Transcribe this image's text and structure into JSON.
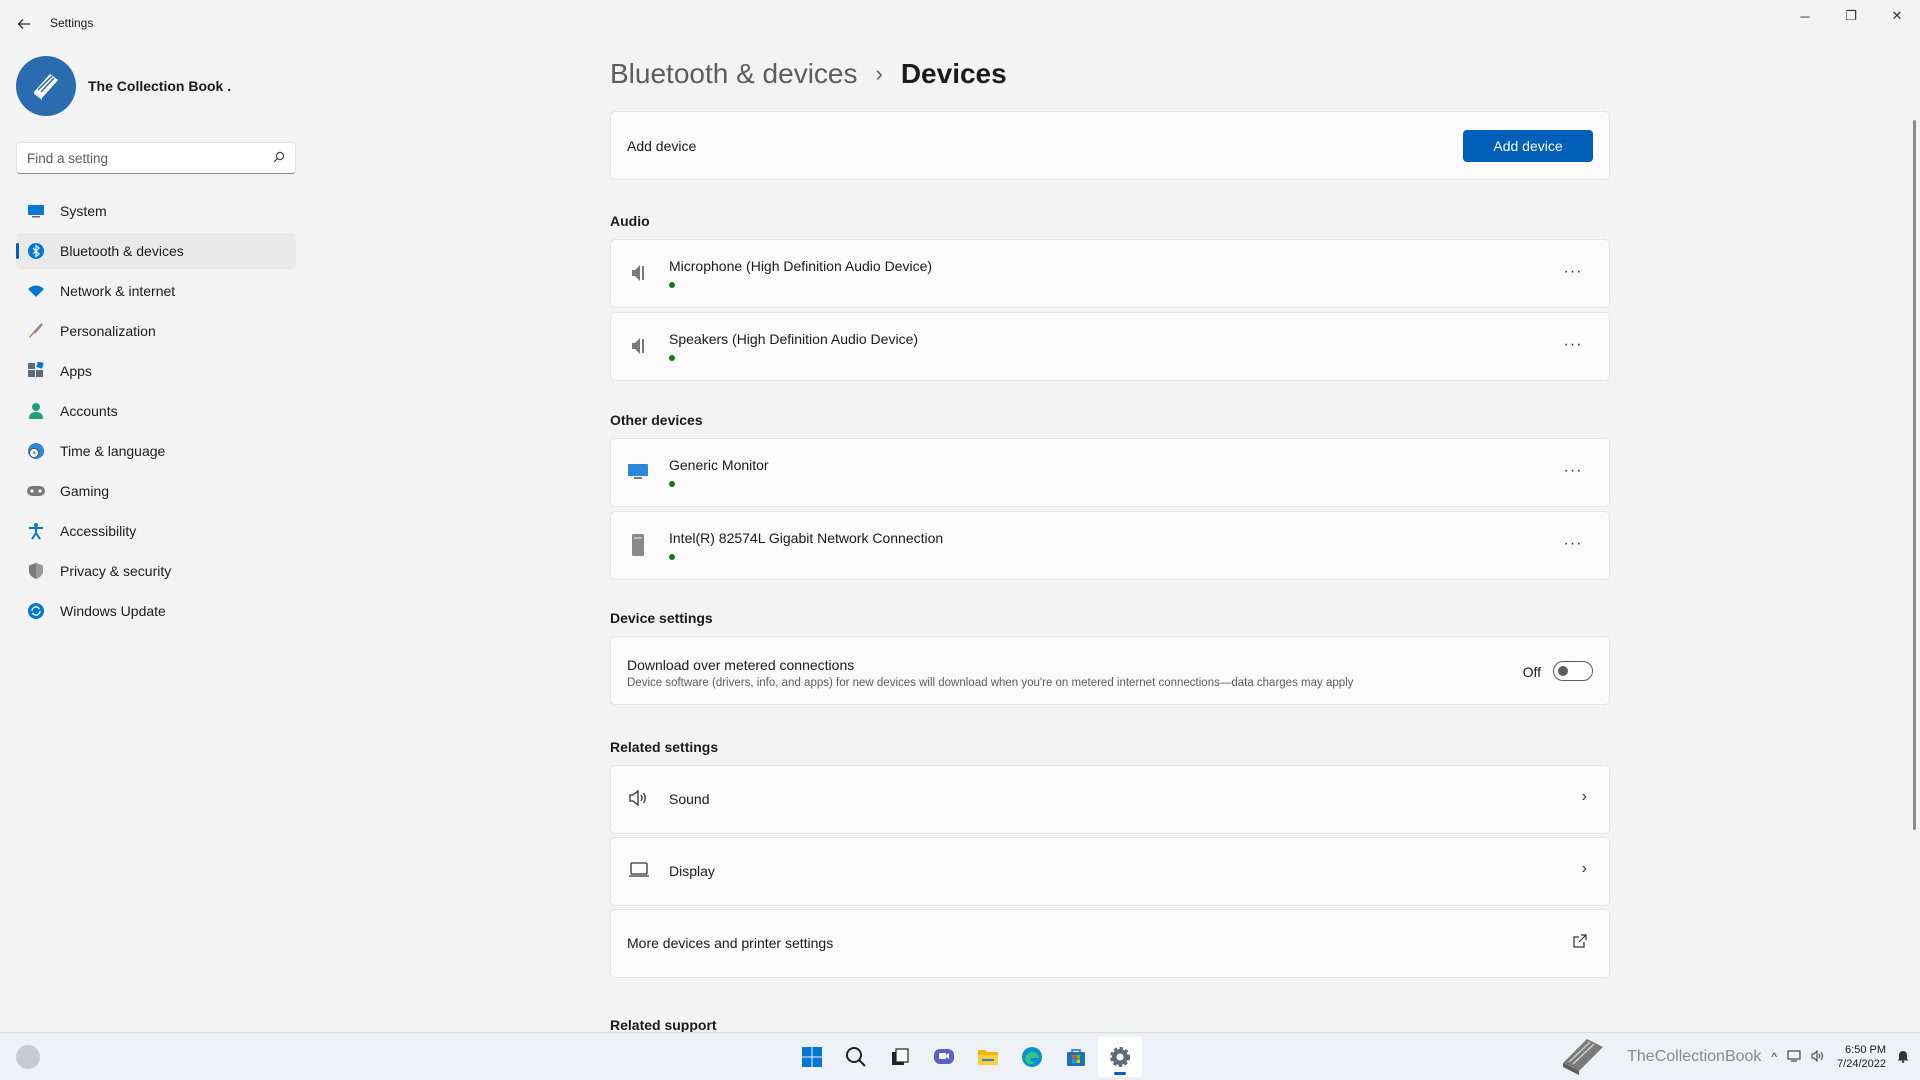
{
  "window": {
    "title": "Settings",
    "back_icon": "back-arrow-icon",
    "controls": {
      "minimize": "─",
      "restore": "❐",
      "close": "✕"
    }
  },
  "profile": {
    "name": "The Collection Book ."
  },
  "search": {
    "placeholder": "Find a setting"
  },
  "sidebar": {
    "items": [
      {
        "label": "System",
        "icon": "monitor-icon",
        "color": "#0078d4"
      },
      {
        "label": "Bluetooth & devices",
        "icon": "bluetooth-icon",
        "color": "#0078d4",
        "active": true
      },
      {
        "label": "Network & internet",
        "icon": "wifi-icon",
        "color": "#0078d4"
      },
      {
        "label": "Personalization",
        "icon": "brush-icon",
        "color": "#e06c26"
      },
      {
        "label": "Apps",
        "icon": "apps-icon",
        "color": "#5d6a7a"
      },
      {
        "label": "Accounts",
        "icon": "person-icon",
        "color": "#1aa37a"
      },
      {
        "label": "Time & language",
        "icon": "globe-clock-icon",
        "color": "#2b88d8"
      },
      {
        "label": "Gaming",
        "icon": "gamepad-icon",
        "color": "#6b6b6b"
      },
      {
        "label": "Accessibility",
        "icon": "accessibility-icon",
        "color": "#0078d4"
      },
      {
        "label": "Privacy & security",
        "icon": "shield-icon",
        "color": "#6b6b6b"
      },
      {
        "label": "Windows Update",
        "icon": "update-icon",
        "color": "#0078d4"
      }
    ]
  },
  "breadcrumb": {
    "parent": "Bluetooth & devices",
    "separator": "›",
    "current": "Devices"
  },
  "add_device": {
    "label": "Add device",
    "button": "Add device"
  },
  "audio": {
    "title": "Audio",
    "devices": [
      {
        "name": "Microphone (High Definition Audio Device)",
        "icon": "speaker-icon"
      },
      {
        "name": "Speakers (High Definition Audio Device)",
        "icon": "speaker-icon"
      }
    ]
  },
  "other_devices": {
    "title": "Other devices",
    "devices": [
      {
        "name": "Generic Monitor",
        "icon": "monitor-icon"
      },
      {
        "name": "Intel(R) 82574L Gigabit Network Connection",
        "icon": "network-device-icon"
      }
    ]
  },
  "device_settings": {
    "title": "Device settings",
    "metered": {
      "title": "Download over metered connections",
      "description": "Device software (drivers, info, and apps) for new devices will download when you're on metered internet connections—data charges may apply",
      "state_label": "Off",
      "enabled": false
    }
  },
  "related_settings": {
    "title": "Related settings",
    "items": [
      {
        "label": "Sound",
        "icon": "volume-icon"
      },
      {
        "label": "Display",
        "icon": "laptop-icon"
      },
      {
        "label": "More devices and printer settings",
        "icon": "external-link-icon"
      }
    ]
  },
  "related_support": {
    "title": "Related support"
  },
  "more_glyph": "···",
  "chevron_glyph": "›",
  "taskbar": {
    "apps": [
      "start-icon",
      "search-icon",
      "task-view-icon",
      "chat-icon",
      "file-explorer-icon",
      "edge-icon",
      "store-icon",
      "settings-icon"
    ],
    "tray_text": "TheCollectionBook",
    "time": "6:50 PM",
    "date": "7/24/2022"
  },
  "colors": {
    "accent": "#005fb8",
    "status_ok": "#0f7b0f"
  }
}
